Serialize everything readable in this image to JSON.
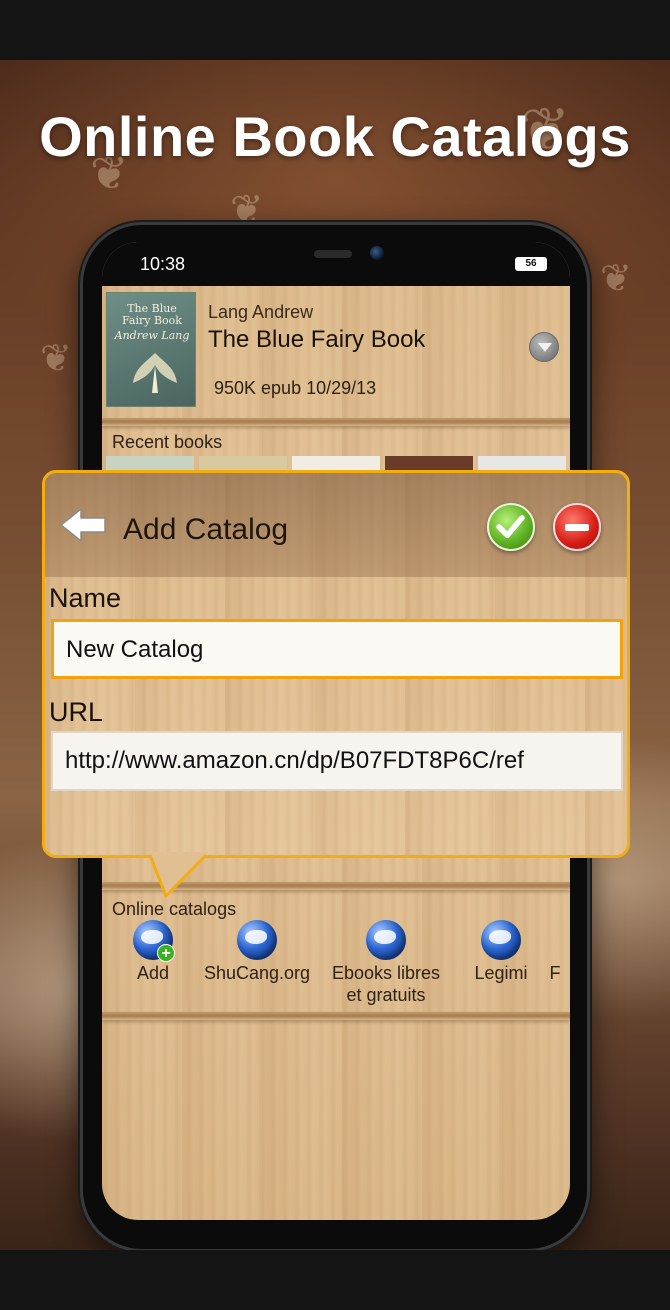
{
  "headline": "Online Book Catalogs",
  "status_bar": {
    "time": "10:38",
    "battery": "56"
  },
  "current_book": {
    "author": "Lang Andrew",
    "title": "The Blue Fairy Book",
    "meta": "950K epub 10/29/13",
    "cover_title_line1": "The Blue",
    "cover_title_line2": "Fairy Book",
    "cover_author": "Andrew Lang"
  },
  "recent_books": {
    "label": "Recent books"
  },
  "dialog": {
    "title": "Add Catalog",
    "name_label": "Name",
    "name_value": "New Catalog",
    "url_label": "URL",
    "url_value": "http://www.amazon.cn/dp/B07FDT8P6C/ref"
  },
  "online_catalogs": {
    "label": "Online catalogs",
    "items": [
      {
        "label": "Add"
      },
      {
        "label": "ShuCang.org"
      },
      {
        "label_line1": "Ebooks libres",
        "label_line2": "et gratuits"
      },
      {
        "label": "Legimi"
      },
      {
        "label": "F"
      }
    ]
  },
  "colors": {
    "accent": "#f2ad12",
    "ok": "#5aae1e",
    "cancel": "#d51c14"
  },
  "icons": {
    "back": "back-arrow-icon",
    "ok": "checkmark-icon",
    "cancel": "minus-icon",
    "dropdown": "chevron-down-icon",
    "catalog": "globe-icon",
    "add_catalog": "globe-plus-icon"
  }
}
